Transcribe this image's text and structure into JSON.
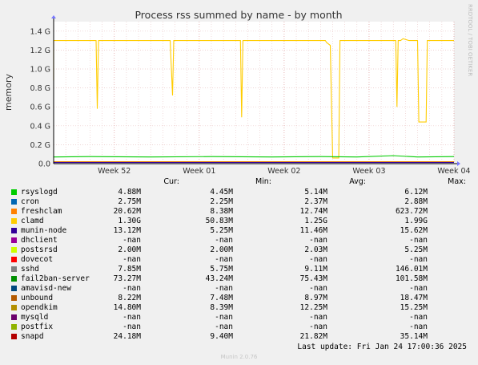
{
  "chart_data": {
    "type": "line",
    "title": "Process rss summed by name - by month",
    "ylabel": "memory",
    "watermark": "RRDTOOL / TOBI OETIKER",
    "ylim": [
      0,
      1.5
    ],
    "y_ticks": [
      {
        "value": 0.0,
        "label": "0.0"
      },
      {
        "value": 0.2,
        "label": "0.2 G"
      },
      {
        "value": 0.4,
        "label": "0.4 G"
      },
      {
        "value": 0.6,
        "label": "0.6 G"
      },
      {
        "value": 0.8,
        "label": "0.8 G"
      },
      {
        "value": 1.0,
        "label": "1.0 G"
      },
      {
        "value": 1.2,
        "label": "1.2 G"
      },
      {
        "value": 1.4,
        "label": "1.4 G"
      }
    ],
    "xlim": [
      0,
      33
    ],
    "x_ticks": [
      {
        "value": 5.0,
        "label": "Week 52"
      },
      {
        "value": 12.0,
        "label": "Week 01"
      },
      {
        "value": 19.0,
        "label": "Week 02"
      },
      {
        "value": 26.0,
        "label": "Week 03"
      },
      {
        "value": 33.0,
        "label": "Week 04"
      }
    ],
    "grid": true,
    "series": [
      {
        "name": "clamd",
        "color": "#ffcc00",
        "points": [
          [
            -2.0,
            1.3
          ],
          [
            -0.6,
            1.3
          ],
          [
            -0.6,
            1.25
          ],
          [
            -0.5,
            1.25
          ],
          [
            -0.4,
            0.88
          ],
          [
            -0.3,
            0.88
          ],
          [
            -0.2,
            1.3
          ],
          [
            3.5,
            1.3
          ],
          [
            3.6,
            0.58
          ],
          [
            3.7,
            1.3
          ],
          [
            9.6,
            1.3
          ],
          [
            9.8,
            0.72
          ],
          [
            9.9,
            1.3
          ],
          [
            15.4,
            1.3
          ],
          [
            15.5,
            0.49
          ],
          [
            15.6,
            1.3
          ],
          [
            22.4,
            1.3
          ],
          [
            22.5,
            1.28
          ],
          [
            22.8,
            1.25
          ],
          [
            23.0,
            0.06
          ],
          [
            23.5,
            0.06
          ],
          [
            23.6,
            1.3
          ],
          [
            28.2,
            1.3
          ],
          [
            28.3,
            0.6
          ],
          [
            28.4,
            1.3
          ],
          [
            28.6,
            1.3
          ],
          [
            28.8,
            1.32
          ],
          [
            29.3,
            1.3
          ],
          [
            30.0,
            1.3
          ],
          [
            30.1,
            0.44
          ],
          [
            30.7,
            0.44
          ],
          [
            30.8,
            1.3
          ],
          [
            33.0,
            1.3
          ]
        ]
      },
      {
        "name": "fail2ban-server",
        "color": "#00cc00",
        "points": [
          [
            -2.0,
            0.07
          ],
          [
            3.0,
            0.075
          ],
          [
            8.0,
            0.07
          ],
          [
            13.0,
            0.075
          ],
          [
            18.0,
            0.07
          ],
          [
            22.0,
            0.075
          ],
          [
            25.0,
            0.07
          ],
          [
            28.0,
            0.085
          ],
          [
            30.0,
            0.07
          ],
          [
            33.0,
            0.075
          ]
        ]
      },
      {
        "name": "freshclam",
        "color": "#ff8000",
        "points": [
          [
            -2.0,
            0.02
          ],
          [
            33.0,
            0.02
          ]
        ]
      },
      {
        "name": "opendkim",
        "color": "#cc9900",
        "points": [
          [
            -2.0,
            0.015
          ],
          [
            33.0,
            0.015
          ]
        ]
      },
      {
        "name": "munin-node",
        "color": "#330099",
        "points": [
          [
            -2.0,
            0.012
          ],
          [
            33.0,
            0.012
          ]
        ]
      }
    ]
  },
  "legend": {
    "headers": {
      "cur": "Cur:",
      "min": "Min:",
      "avg": "Avg:",
      "max": "Max:"
    },
    "rows": [
      {
        "name": "rsyslogd",
        "color": "#00cc00",
        "cur": "4.88M",
        "min": "4.45M",
        "avg": "5.14M",
        "max": "6.12M"
      },
      {
        "name": "cron",
        "color": "#0066b3",
        "cur": "2.75M",
        "min": "2.25M",
        "avg": "2.37M",
        "max": "2.88M"
      },
      {
        "name": "freshclam",
        "color": "#ff8000",
        "cur": "20.62M",
        "min": "8.38M",
        "avg": "12.74M",
        "max": "623.72M"
      },
      {
        "name": "clamd",
        "color": "#ffcc00",
        "cur": "1.30G",
        "min": "50.83M",
        "avg": "1.25G",
        "max": "1.99G"
      },
      {
        "name": "munin-node",
        "color": "#330099",
        "cur": "13.12M",
        "min": "5.25M",
        "avg": "11.46M",
        "max": "15.62M"
      },
      {
        "name": "dhclient",
        "color": "#990099",
        "cur": "-nan",
        "min": "-nan",
        "avg": "-nan",
        "max": "-nan"
      },
      {
        "name": "postsrsd",
        "color": "#ccff00",
        "cur": "2.00M",
        "min": "2.00M",
        "avg": "2.03M",
        "max": "5.25M"
      },
      {
        "name": "dovecot",
        "color": "#ff0000",
        "cur": "-nan",
        "min": "-nan",
        "avg": "-nan",
        "max": "-nan"
      },
      {
        "name": "sshd",
        "color": "#808080",
        "cur": "7.85M",
        "min": "5.75M",
        "avg": "9.11M",
        "max": "146.01M"
      },
      {
        "name": "fail2ban-server",
        "color": "#008f00",
        "cur": "73.27M",
        "min": "43.24M",
        "avg": "75.43M",
        "max": "101.58M"
      },
      {
        "name": "amavisd-new",
        "color": "#00487d",
        "cur": "-nan",
        "min": "-nan",
        "avg": "-nan",
        "max": "-nan"
      },
      {
        "name": "unbound",
        "color": "#b35a00",
        "cur": "8.22M",
        "min": "7.48M",
        "avg": "8.97M",
        "max": "18.47M"
      },
      {
        "name": "opendkim",
        "color": "#b38f00",
        "cur": "14.80M",
        "min": "8.39M",
        "avg": "12.25M",
        "max": "15.25M"
      },
      {
        "name": "mysqld",
        "color": "#6b006b",
        "cur": "-nan",
        "min": "-nan",
        "avg": "-nan",
        "max": "-nan"
      },
      {
        "name": "postfix",
        "color": "#8fb300",
        "cur": "-nan",
        "min": "-nan",
        "avg": "-nan",
        "max": "-nan"
      },
      {
        "name": "snapd",
        "color": "#b30000",
        "cur": "24.18M",
        "min": "9.40M",
        "avg": "21.82M",
        "max": "35.14M"
      }
    ]
  },
  "footer": {
    "last_update": "Last update: Fri Jan 24 17:00:36 2025",
    "munin": "Munin 2.0.76"
  }
}
